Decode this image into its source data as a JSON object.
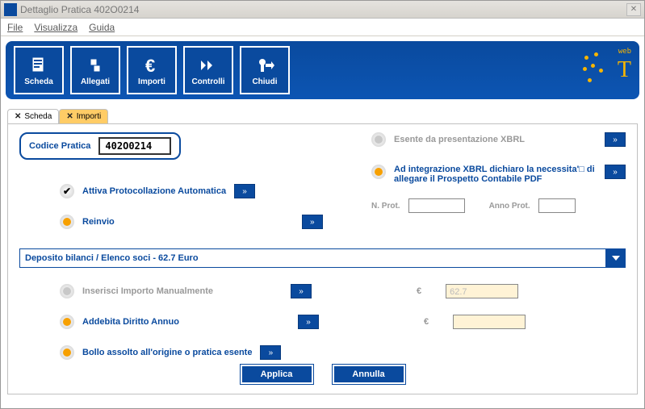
{
  "window": {
    "title": "Dettaglio Pratica 402O0214"
  },
  "menu": {
    "file": "File",
    "visualizza": "Visualizza",
    "guida": "Guida"
  },
  "toolbar": {
    "scheda": "Scheda",
    "allegati": "Allegati",
    "importi": "Importi",
    "controlli": "Controlli",
    "chiudi": "Chiudi",
    "web": "web"
  },
  "tabs": {
    "scheda": "Scheda",
    "importi": "Importi"
  },
  "codice": {
    "label": "Codice Pratica",
    "value": "402O0214"
  },
  "left": {
    "attiva_protocollazione": "Attiva Protocollazione Automatica",
    "reinvio": "Reinvio",
    "inserisci_manualmente": "Inserisci Importo Manualmente",
    "addebita_diritto": "Addebita Diritto Annuo",
    "bollo_assolto": "Bollo assolto all'origine o pratica esente"
  },
  "right": {
    "esente_xbrl": "Esente da presentazione XBRL",
    "integrazione_xbrl": "Ad integrazione XBRL dichiaro la necessita'□ di allegare il Prospetto Contabile PDF",
    "n_prot": "N. Prot.",
    "anno_prot": "Anno Prot."
  },
  "combo": {
    "selected": "Deposito bilanci / Elenco soci - 62.7 Euro",
    "amount": "62.7"
  },
  "euro": "€",
  "buttons": {
    "applica": "Applica",
    "annulla": "Annulla"
  }
}
